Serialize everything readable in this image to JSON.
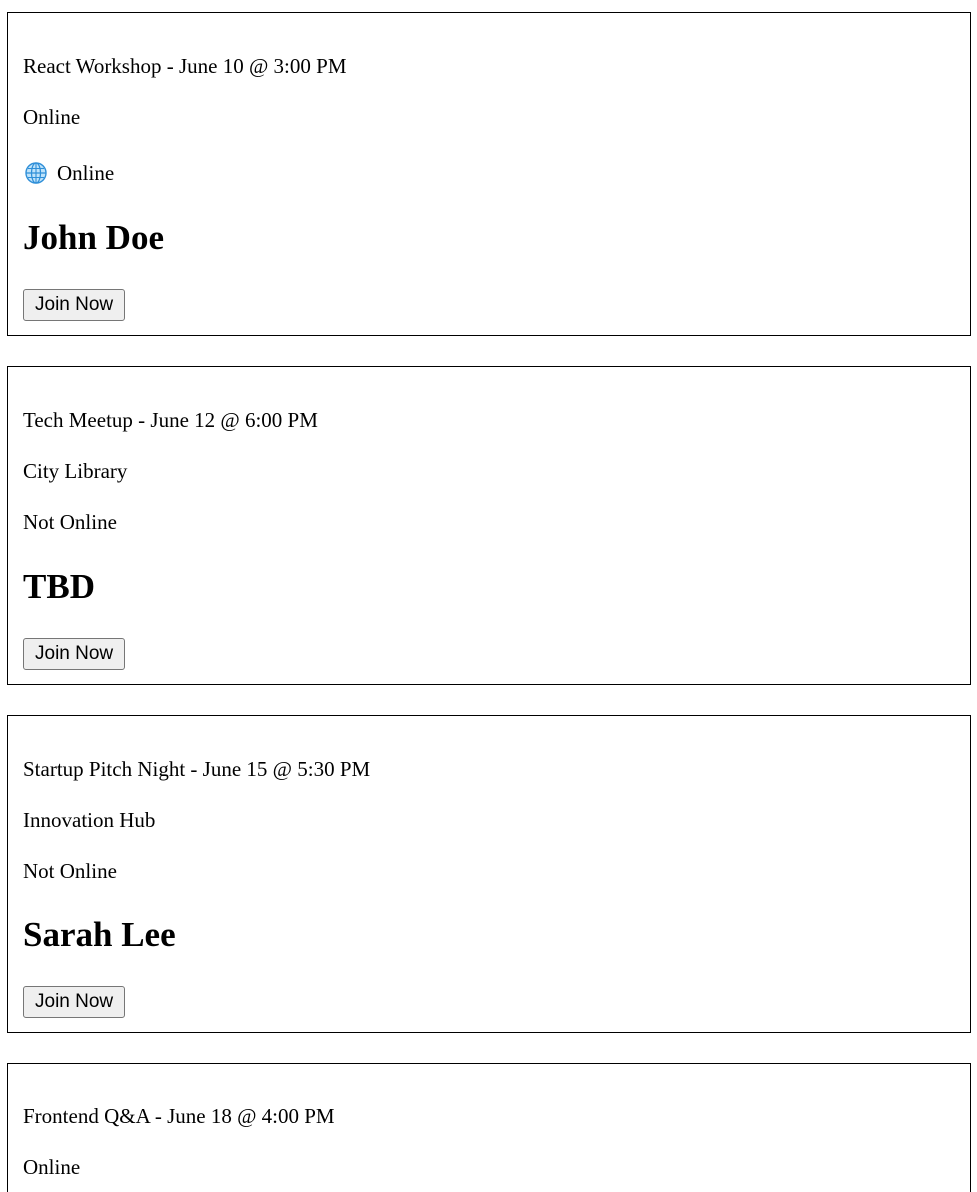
{
  "events": [
    {
      "title": "React Workshop - June 10 @ 3:00 PM",
      "location": "Online",
      "status_icon": "globe-icon",
      "status": "Online",
      "host": "John Doe",
      "button_label": "Join Now"
    },
    {
      "title": "Tech Meetup - June 12 @ 6:00 PM",
      "location": "City Library",
      "status": "Not Online",
      "host": "TBD",
      "button_label": "Join Now"
    },
    {
      "title": "Startup Pitch Night - June 15 @ 5:30 PM",
      "location": "Innovation Hub",
      "status": "Not Online",
      "host": "Sarah Lee",
      "button_label": "Join Now"
    },
    {
      "title": "Frontend Q&A - June 18 @ 4:00 PM",
      "location": "Online"
    }
  ],
  "colors": {
    "border": "#000000",
    "button_bg": "#efefef",
    "button_border": "#767676",
    "globe_blue": "#2f8fd8",
    "globe_fill": "#bfe3fa"
  }
}
